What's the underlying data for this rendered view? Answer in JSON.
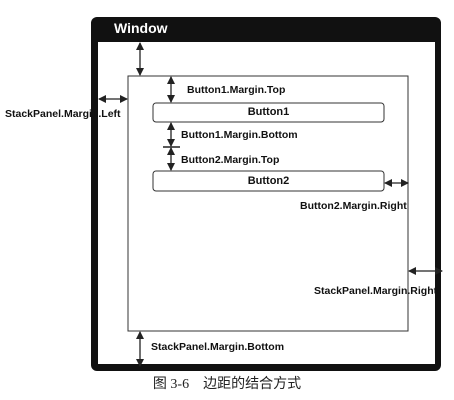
{
  "window": {
    "title": "Window"
  },
  "buttons": {
    "button1": "Button1",
    "button2": "Button2"
  },
  "labels": {
    "button1_margin_top": "Button1.Margin.Top",
    "button1_margin_bottom": "Button1.Margin.Bottom",
    "button2_margin_top": "Button2.Margin.Top",
    "button2_margin_right": "Button2.Margin.Right",
    "stackpanel_margin_left": "StackPanel.Margin.Left",
    "stackpanel_margin_right": "StackPanel.Margin.Right",
    "stackpanel_margin_bottom": "StackPanel.Margin.Bottom"
  },
  "caption": "图 3-6　边距的结合方式",
  "colors": {
    "window_frame": "#111111",
    "background": "#ffffff",
    "line": "#222222"
  }
}
